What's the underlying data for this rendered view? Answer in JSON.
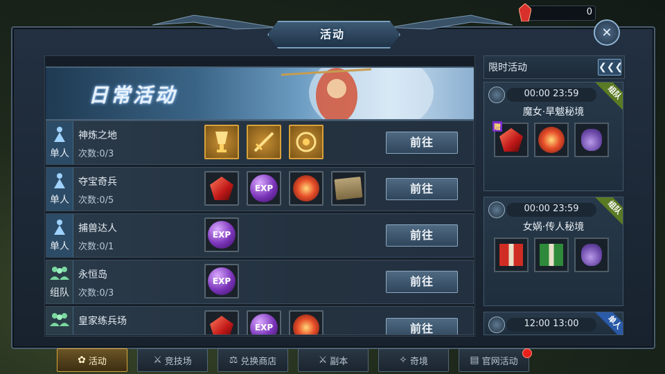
{
  "currency": {
    "value": "0",
    "icon": "red-crystal-icon"
  },
  "window": {
    "title": "活动"
  },
  "daily": {
    "banner_title": "日常活动",
    "rows": [
      {
        "type": "单人",
        "type_icon": "single-player-icon",
        "name": "神炼之地",
        "count": "次数:0/3",
        "button": "前往",
        "rewards": [
          "gold-trophy-icon",
          "gold-sword-icon",
          "gold-amulet-icon"
        ]
      },
      {
        "type": "单人",
        "type_icon": "single-player-icon",
        "name": "夺宝奇兵",
        "count": "次数:0/5",
        "button": "前往",
        "rewards": [
          "red-crystal-icon",
          "exp-orb-icon",
          "fire-orb-icon",
          "map-scroll-icon"
        ]
      },
      {
        "type": "单人",
        "type_icon": "single-player-icon",
        "name": "捕兽达人",
        "count": "次数:0/1",
        "button": "前往",
        "rewards": [
          "exp-orb-icon"
        ]
      },
      {
        "type": "组队",
        "type_icon": "team-icon",
        "name": "永恒岛",
        "count": "次数:0/3",
        "button": "前往",
        "rewards": [
          "exp-orb-icon"
        ]
      },
      {
        "type": "",
        "type_icon": "team-icon",
        "name": "皇家练兵场",
        "count": "",
        "button": "前往",
        "rewards": [
          "red-crystal-icon",
          "exp-orb-icon",
          "fire-orb-icon"
        ]
      }
    ],
    "exp_label": "EXP"
  },
  "limited": {
    "header": "限时活动",
    "collapse_icon": "triple-chevron-left-icon",
    "events": [
      {
        "time": "00:00  23:59",
        "tag": "组队",
        "name": "魔女·旱魃秘境",
        "gift_badge": "赠",
        "items": [
          "red-crystal-icon",
          "fire-orb-icon",
          "purple-bag-icon"
        ]
      },
      {
        "time": "00:00  23:59",
        "tag": "组队",
        "name": "女娲·传人秘境",
        "items": [
          "red-giftbox-icon",
          "green-giftbox-icon",
          "purple-bag-icon"
        ]
      },
      {
        "time": "12:00  13:00",
        "tag": "单人"
      }
    ]
  },
  "nav": [
    {
      "label": "活动",
      "icon": "flower-icon",
      "active": true
    },
    {
      "label": "竞技场",
      "icon": "crossed-swords-icon",
      "active": false
    },
    {
      "label": "兑换商店",
      "icon": "scales-icon",
      "active": false
    },
    {
      "label": "副本",
      "icon": "crossed-swords-icon",
      "active": false
    },
    {
      "label": "奇境",
      "icon": "star-crest-icon",
      "active": false
    },
    {
      "label": "官网活动",
      "icon": "book-icon",
      "active": false
    }
  ],
  "colors": {
    "accent_gold": "#d9a53a",
    "panel_blue": "#223041",
    "button_blue": "#4f6a82",
    "notify_red": "#e8201c"
  }
}
